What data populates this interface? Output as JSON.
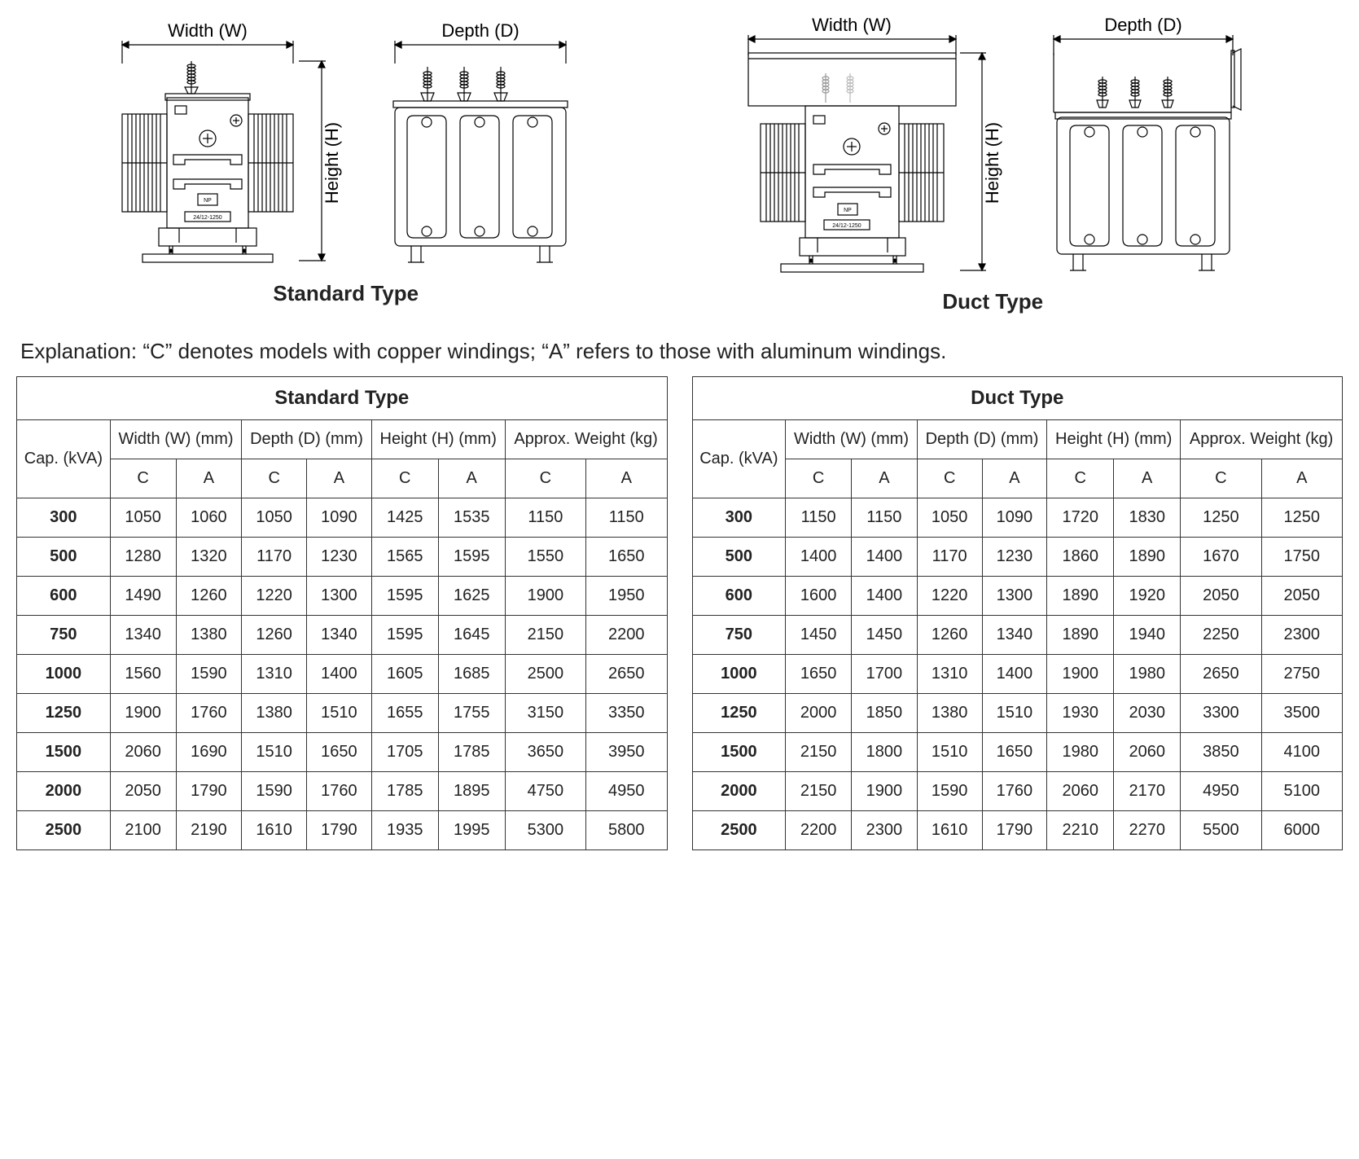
{
  "dim_labels": {
    "width": "Width (W)",
    "depth": "Depth (D)",
    "height": "Height (H)",
    "model_label": "24/12-1250",
    "np_label": "NP"
  },
  "type_labels": {
    "standard": "Standard Type",
    "duct": "Duct Type"
  },
  "explanation": "Explanation: “C” denotes models with copper windings; “A” refers to those with aluminum windings.",
  "table_headers": {
    "cap": "Cap. (kVA)",
    "width": "Width (W) (mm)",
    "depth": "Depth (D) (mm)",
    "height": "Height (H) (mm)",
    "weight": "Approx. Weight (kg)",
    "c": "C",
    "a": "A"
  },
  "chart_data": [
    {
      "type": "table",
      "title": "Standard Type",
      "columns": [
        "Cap. (kVA)",
        "Width C",
        "Width A",
        "Depth C",
        "Depth A",
        "Height C",
        "Height A",
        "Weight C",
        "Weight A"
      ],
      "rows": [
        {
          "cap": "300",
          "wc": "1050",
          "wa": "1060",
          "dc": "1050",
          "da": "1090",
          "hc": "1425",
          "ha": "1535",
          "gc": "1150",
          "ga": "1150"
        },
        {
          "cap": "500",
          "wc": "1280",
          "wa": "1320",
          "dc": "1170",
          "da": "1230",
          "hc": "1565",
          "ha": "1595",
          "gc": "1550",
          "ga": "1650"
        },
        {
          "cap": "600",
          "wc": "1490",
          "wa": "1260",
          "dc": "1220",
          "da": "1300",
          "hc": "1595",
          "ha": "1625",
          "gc": "1900",
          "ga": "1950"
        },
        {
          "cap": "750",
          "wc": "1340",
          "wa": "1380",
          "dc": "1260",
          "da": "1340",
          "hc": "1595",
          "ha": "1645",
          "gc": "2150",
          "ga": "2200"
        },
        {
          "cap": "1000",
          "wc": "1560",
          "wa": "1590",
          "dc": "1310",
          "da": "1400",
          "hc": "1605",
          "ha": "1685",
          "gc": "2500",
          "ga": "2650"
        },
        {
          "cap": "1250",
          "wc": "1900",
          "wa": "1760",
          "dc": "1380",
          "da": "1510",
          "hc": "1655",
          "ha": "1755",
          "gc": "3150",
          "ga": "3350"
        },
        {
          "cap": "1500",
          "wc": "2060",
          "wa": "1690",
          "dc": "1510",
          "da": "1650",
          "hc": "1705",
          "ha": "1785",
          "gc": "3650",
          "ga": "3950"
        },
        {
          "cap": "2000",
          "wc": "2050",
          "wa": "1790",
          "dc": "1590",
          "da": "1760",
          "hc": "1785",
          "ha": "1895",
          "gc": "4750",
          "ga": "4950"
        },
        {
          "cap": "2500",
          "wc": "2100",
          "wa": "2190",
          "dc": "1610",
          "da": "1790",
          "hc": "1935",
          "ha": "1995",
          "gc": "5300",
          "ga": "5800"
        }
      ]
    },
    {
      "type": "table",
      "title": "Duct Type",
      "columns": [
        "Cap. (kVA)",
        "Width C",
        "Width A",
        "Depth C",
        "Depth A",
        "Height C",
        "Height A",
        "Weight C",
        "Weight A"
      ],
      "rows": [
        {
          "cap": "300",
          "wc": "1150",
          "wa": "1150",
          "dc": "1050",
          "da": "1090",
          "hc": "1720",
          "ha": "1830",
          "gc": "1250",
          "ga": "1250"
        },
        {
          "cap": "500",
          "wc": "1400",
          "wa": "1400",
          "dc": "1170",
          "da": "1230",
          "hc": "1860",
          "ha": "1890",
          "gc": "1670",
          "ga": "1750"
        },
        {
          "cap": "600",
          "wc": "1600",
          "wa": "1400",
          "dc": "1220",
          "da": "1300",
          "hc": "1890",
          "ha": "1920",
          "gc": "2050",
          "ga": "2050"
        },
        {
          "cap": "750",
          "wc": "1450",
          "wa": "1450",
          "dc": "1260",
          "da": "1340",
          "hc": "1890",
          "ha": "1940",
          "gc": "2250",
          "ga": "2300"
        },
        {
          "cap": "1000",
          "wc": "1650",
          "wa": "1700",
          "dc": "1310",
          "da": "1400",
          "hc": "1900",
          "ha": "1980",
          "gc": "2650",
          "ga": "2750"
        },
        {
          "cap": "1250",
          "wc": "2000",
          "wa": "1850",
          "dc": "1380",
          "da": "1510",
          "hc": "1930",
          "ha": "2030",
          "gc": "3300",
          "ga": "3500"
        },
        {
          "cap": "1500",
          "wc": "2150",
          "wa": "1800",
          "dc": "1510",
          "da": "1650",
          "hc": "1980",
          "ha": "2060",
          "gc": "3850",
          "ga": "4100"
        },
        {
          "cap": "2000",
          "wc": "2150",
          "wa": "1900",
          "dc": "1590",
          "da": "1760",
          "hc": "2060",
          "ha": "2170",
          "gc": "4950",
          "ga": "5100"
        },
        {
          "cap": "2500",
          "wc": "2200",
          "wa": "2300",
          "dc": "1610",
          "da": "1790",
          "hc": "2210",
          "ha": "2270",
          "gc": "5500",
          "ga": "6000"
        }
      ]
    }
  ]
}
